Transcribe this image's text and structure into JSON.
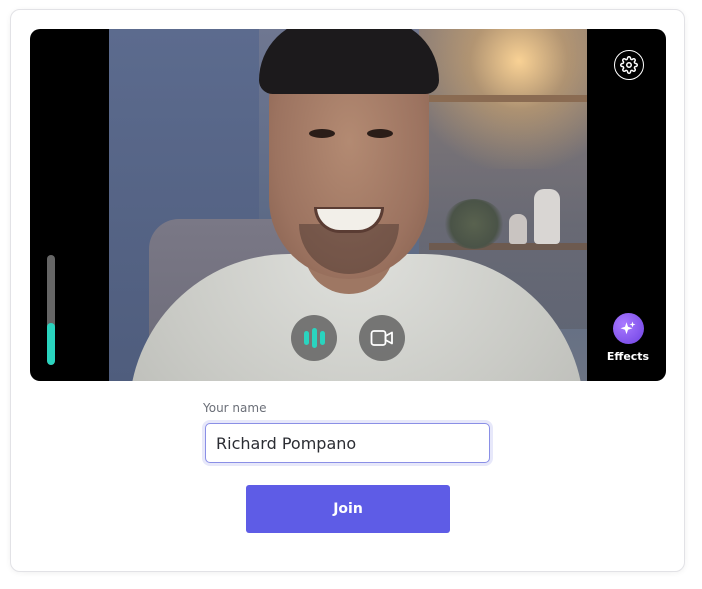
{
  "preview": {
    "mic_level_fraction": 0.38,
    "effects_label": "Effects",
    "accent_color": "#2ad4bf",
    "effects_color": "#7a4de8"
  },
  "icons": {
    "settings": "gear-icon",
    "mic": "mic-level-icon",
    "camera": "video-camera-icon",
    "effects": "sparkle-icon"
  },
  "form": {
    "name_label": "Your name",
    "name_value": "Richard Pompano",
    "join_label": "Join",
    "button_color": "#5e5ce6"
  }
}
